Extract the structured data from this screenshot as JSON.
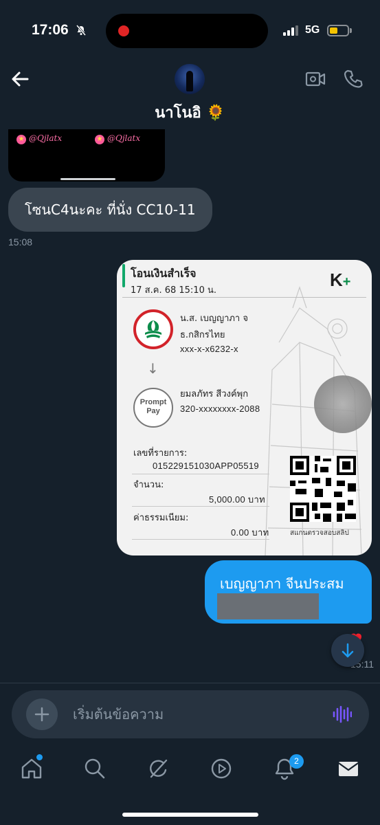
{
  "status_bar": {
    "time": "17:06",
    "network": "5G",
    "battery_color": "#f5c400"
  },
  "header": {
    "contact_name": "นาโนอิ 🌻"
  },
  "chat": {
    "media_stickers": [
      "@Qjlatx",
      "@Qjlatx"
    ],
    "incoming_message": {
      "text": "โซนC4นะคะ ที่นั่ง CC10-11",
      "time": "15:08"
    },
    "transfer_slip": {
      "title": "โอนเงินสำเร็จ",
      "date": "17 ส.ค. 68  15:10 น.",
      "brand": "K",
      "brand_plus": "+",
      "sender_name": "น.ส. เบญญาภา จ",
      "sender_bank": "ธ.กสิกรไทย",
      "sender_account": "xxx-x-x6232-x",
      "promptpay_label": "Prompt Pay",
      "receiver_name": "ยมลภัทร สีวงค์พุก",
      "receiver_account": "320-xxxxxxxx-2088",
      "ref_label": "เลขที่รายการ:",
      "ref_value": "015229151030APP05519",
      "amount_label": "จำนวน:",
      "amount_value": "5,000.00 บาท",
      "fee_label": "ค่าธรรมเนียม:",
      "fee_value": "0.00 บาท",
      "qr_caption": "สแกนตรวจสอบสลิป"
    },
    "outgoing_message": {
      "text": "เบญญาภา จีนประสม",
      "time": "15:11"
    },
    "accent_color": "#1d9bf0"
  },
  "composer": {
    "placeholder": "เริ่มต้นข้อความ"
  },
  "nav": {
    "items": [
      "home",
      "search",
      "grok",
      "video",
      "notifications",
      "messages"
    ],
    "notification_count": "2"
  }
}
